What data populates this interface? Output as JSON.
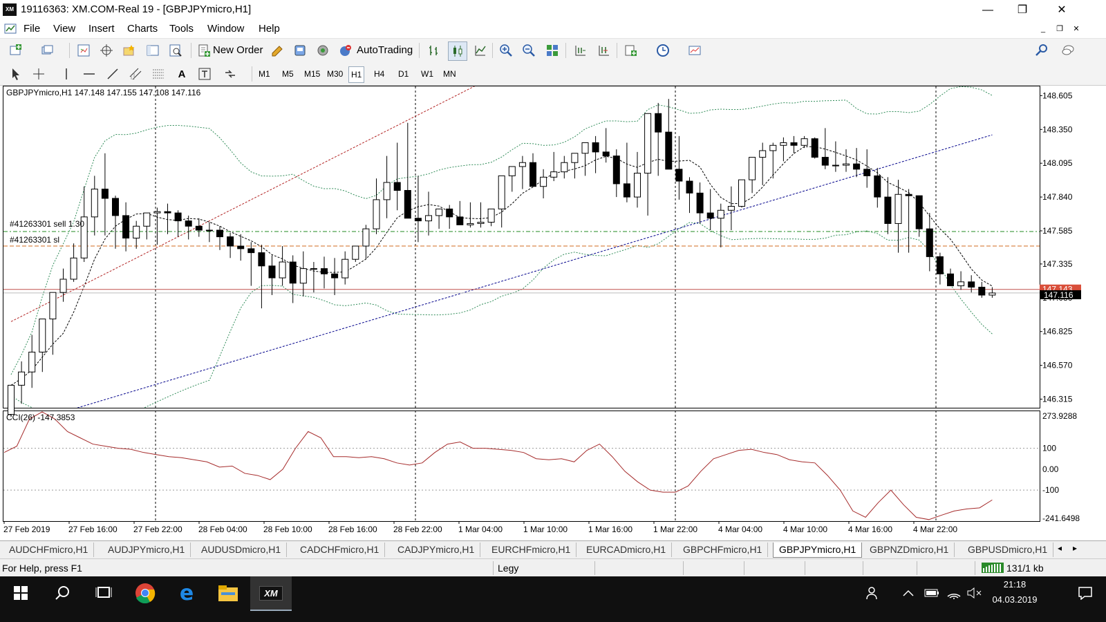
{
  "window": {
    "title": "19116363: XM.COM-Real 19 - [GBPJPYmicro,H1]",
    "logo_text": "XM",
    "minimize": "—",
    "restore": "❐",
    "close": "✕"
  },
  "menu": {
    "items": [
      "File",
      "View",
      "Insert",
      "Charts",
      "Tools",
      "Window",
      "Help"
    ],
    "mdi_minimize": "_",
    "mdi_restore": "❐",
    "mdi_close": "✕"
  },
  "toolbar": {
    "new_order_label": "New Order",
    "autotrading_label": "AutoTrading",
    "icons": [
      "new-chart-icon",
      "profiles-icon",
      "market-watch-icon",
      "navigator-icon",
      "favorites-icon",
      "terminal-icon",
      "strategy-tester-icon",
      "new-order-icon",
      "metaeditor-icon",
      "history-icon",
      "signals-icon",
      "autotrading-icon",
      "bar-chart-icon",
      "candlestick-icon",
      "line-chart-icon",
      "zoom-in-icon",
      "zoom-out-icon",
      "tile-windows-icon",
      "autoscroll-icon",
      "chart-shift-icon",
      "indicators-icon",
      "periods-icon",
      "templates-icon",
      "search-icon",
      "chat-icon"
    ]
  },
  "timeframes": [
    "M1",
    "M5",
    "M15",
    "M30",
    "H1",
    "H4",
    "D1",
    "W1",
    "MN"
  ],
  "active_timeframe": "H1",
  "chart": {
    "header": "GBPJPYmicro,H1  147.148 147.155 147.108 147.116",
    "order_label_sell": "#41263301 sell 1.30",
    "order_label_sl": "#41263301 sl",
    "current_price_label": "147.116",
    "hidden_price_label": "147.143",
    "price_ticks": [
      "148.605",
      "148.350",
      "148.095",
      "147.840",
      "147.585",
      "147.335",
      "147.080",
      "146.825",
      "146.570",
      "146.315"
    ],
    "indicator_label": "CCI(26) -147.3853",
    "indicator_ticks": [
      "273.9288",
      "100",
      "0.00",
      "-100",
      "-241.6498"
    ],
    "time_labels": [
      "27 Feb 2019",
      "27 Feb 16:00",
      "27 Feb 22:00",
      "28 Feb 04:00",
      "28 Feb 10:00",
      "28 Feb 16:00",
      "28 Feb 22:00",
      "1 Mar 04:00",
      "1 Mar 10:00",
      "1 Mar 16:00",
      "1 Mar 22:00",
      "4 Mar 04:00",
      "4 Mar 10:00",
      "4 Mar 16:00",
      "4 Mar 22:00"
    ],
    "colors": {
      "up_candle": "#ffffff",
      "down_candle": "#000000",
      "bollinger": "#2e8b57",
      "ma_black": "#000000",
      "ma_red": "#b22222",
      "ma_blue": "#00008b",
      "order_line": "#228b22",
      "sl_line": "#d2691e",
      "bid_line": "#c0504d",
      "cci": "#a52a2a"
    }
  },
  "chart_data": {
    "type": "candlestick",
    "symbol": "GBPJPYmicro",
    "timeframe": "H1",
    "ylim": [
      146.25,
      148.68
    ],
    "open": [
      146.2,
      146.42,
      146.52,
      146.67,
      146.92,
      147.12,
      147.22,
      147.38,
      147.69,
      147.9,
      147.83,
      147.7,
      147.53,
      147.62,
      147.72,
      147.73,
      147.72,
      147.66,
      147.62,
      147.59,
      147.59,
      147.54,
      147.47,
      147.45,
      147.42,
      147.32,
      147.23,
      147.35,
      147.19,
      147.3,
      147.3,
      147.26,
      147.23,
      147.37,
      147.47,
      147.6,
      147.82,
      147.95,
      147.89,
      147.68,
      147.66,
      147.7,
      147.75,
      147.69,
      147.63,
      147.64,
      147.65,
      147.75,
      148.0,
      148.07,
      148.1,
      147.92,
      147.99,
      148.03,
      148.1,
      148.17,
      148.25,
      148.18,
      148.15,
      147.94,
      147.84,
      148.02,
      148.47,
      148.33,
      148.05,
      147.96,
      147.87,
      147.72,
      147.68,
      147.74,
      147.77,
      147.97,
      148.14,
      148.19,
      148.23,
      148.25,
      148.23,
      148.28,
      148.14,
      148.08,
      148.08,
      148.09,
      148.05,
      148.0,
      147.84,
      147.64,
      147.86,
      147.85,
      147.6,
      147.39,
      147.26,
      147.17,
      147.2,
      147.16,
      147.1
    ],
    "high": [
      146.35,
      146.6,
      146.8,
      146.9,
      147.1,
      147.3,
      147.49,
      147.92,
      148.0,
      148.17,
      147.85,
      147.8,
      147.66,
      147.68,
      147.76,
      147.79,
      147.74,
      147.7,
      147.68,
      147.65,
      147.62,
      147.57,
      147.56,
      147.5,
      147.48,
      147.4,
      147.47,
      147.4,
      147.43,
      147.35,
      147.39,
      147.38,
      147.43,
      147.47,
      147.63,
      147.98,
      148.15,
      148.25,
      148.4,
      148.0,
      147.88,
      147.72,
      147.78,
      147.81,
      147.8,
      147.8,
      147.71,
      147.82,
      148.06,
      148.15,
      148.17,
      148.05,
      148.18,
      148.15,
      148.12,
      148.2,
      148.3,
      148.36,
      148.2,
      148.25,
      148.18,
      148.03,
      148.55,
      148.58,
      148.3,
      147.99,
      147.95,
      147.9,
      147.79,
      147.92,
      147.96,
      148.1,
      148.25,
      148.25,
      148.29,
      148.3,
      148.3,
      148.29,
      148.36,
      148.26,
      148.2,
      148.21,
      148.2,
      148.06,
      147.99,
      147.97,
      147.9,
      147.78,
      147.72,
      147.42,
      147.3,
      147.28,
      147.25,
      147.2,
      147.16
    ],
    "low": [
      146.18,
      146.28,
      146.4,
      146.52,
      146.65,
      147.05,
      147.2,
      147.35,
      147.55,
      147.55,
      147.45,
      147.43,
      147.45,
      147.52,
      147.48,
      147.56,
      147.54,
      147.52,
      147.54,
      147.5,
      147.44,
      147.38,
      147.36,
      147.17,
      147.0,
      147.1,
      147.17,
      147.04,
      147.09,
      147.12,
      147.15,
      147.1,
      147.18,
      147.35,
      147.37,
      147.56,
      147.68,
      147.74,
      147.82,
      147.5,
      147.55,
      147.6,
      147.6,
      147.66,
      147.61,
      147.61,
      147.62,
      147.61,
      147.88,
      147.9,
      147.98,
      147.83,
      147.96,
      147.98,
      147.98,
      148.0,
      148.02,
      148.1,
      147.84,
      147.8,
      147.76,
      147.7,
      148.0,
      148.06,
      147.82,
      147.72,
      147.64,
      147.59,
      147.46,
      147.59,
      147.76,
      147.87,
      147.93,
      147.98,
      148.11,
      148.17,
      148.21,
      148.13,
      148.05,
      148.03,
      148.03,
      147.99,
      147.91,
      147.76,
      147.56,
      147.42,
      147.42,
      147.54,
      147.28,
      147.18,
      147.18,
      147.14,
      147.12,
      147.08,
      147.08
    ],
    "close": [
      146.42,
      146.52,
      146.67,
      146.92,
      147.12,
      147.22,
      147.38,
      147.69,
      147.9,
      147.83,
      147.7,
      147.53,
      147.62,
      147.72,
      147.73,
      147.72,
      147.66,
      147.62,
      147.59,
      147.59,
      147.54,
      147.47,
      147.45,
      147.42,
      147.32,
      147.23,
      147.35,
      147.19,
      147.3,
      147.3,
      147.26,
      147.23,
      147.37,
      147.47,
      147.6,
      147.82,
      147.95,
      147.89,
      147.68,
      147.66,
      147.7,
      147.75,
      147.69,
      147.63,
      147.64,
      147.65,
      147.75,
      148.0,
      148.07,
      148.1,
      147.92,
      147.99,
      148.03,
      148.1,
      148.17,
      148.25,
      148.18,
      148.15,
      147.94,
      147.84,
      148.02,
      148.47,
      148.33,
      148.05,
      147.96,
      147.87,
      147.72,
      147.68,
      147.74,
      147.77,
      147.97,
      148.14,
      148.19,
      148.23,
      148.25,
      148.23,
      148.28,
      148.14,
      148.08,
      148.08,
      148.09,
      148.05,
      148.0,
      147.84,
      147.64,
      147.86,
      147.85,
      147.6,
      147.39,
      147.26,
      147.17,
      147.2,
      147.16,
      147.1,
      147.116
    ],
    "cci": [
      80,
      110,
      240,
      274,
      240,
      180,
      150,
      120,
      110,
      100,
      95,
      80,
      70,
      60,
      55,
      45,
      35,
      10,
      15,
      -20,
      -30,
      -50,
      0,
      100,
      180,
      150,
      60,
      60,
      55,
      60,
      50,
      30,
      20,
      30,
      80,
      120,
      130,
      100,
      100,
      95,
      90,
      80,
      50,
      45,
      50,
      35,
      90,
      120,
      60,
      -10,
      -60,
      -100,
      -110,
      -110,
      -80,
      -10,
      50,
      70,
      90,
      95,
      80,
      70,
      45,
      35,
      30,
      -30,
      -100,
      -200,
      -230,
      -160,
      -100,
      -170,
      -230,
      -241,
      -220,
      -200,
      -190,
      -185,
      -147
    ],
    "cci_ylim": [
      -241.6498,
      273.9288
    ],
    "order_sell_price": 147.58,
    "order_sl_price": 147.47,
    "bid_price": 147.143
  },
  "tabs": [
    "AUDCHFmicro,H1",
    "AUDJPYmicro,H1",
    "AUDUSDmicro,H1",
    "CADCHFmicro,H1",
    "CADJPYmicro,H1",
    "EURCHFmicro,H1",
    "EURCADmicro,H1",
    "GBPCHFmicro,H1",
    "GBPJPYmicro,H1",
    "GBPNZDmicro,H1",
    "GBPUSDmicro,H1"
  ],
  "active_tab": "GBPJPYmicro,H1",
  "tab_scroll_left": "◂",
  "tab_scroll_right": "▸",
  "status": {
    "help_text": "For Help, press F1",
    "profile": "Legy",
    "connection": "131/1 kb"
  },
  "taskbar": {
    "time": "21:18",
    "date": "04.03.2019",
    "apps": [
      "start-icon",
      "search-icon",
      "task-view-icon",
      "chrome-icon",
      "edge-icon",
      "file-explorer-icon",
      "xm-terminal-icon"
    ],
    "xm_label": "XM"
  }
}
